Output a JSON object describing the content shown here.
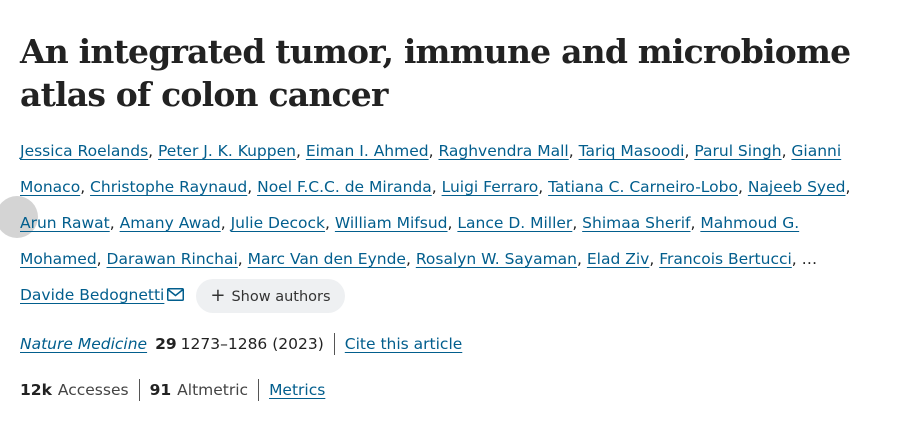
{
  "article": {
    "title": "An integrated tumor, immune and microbiome atlas of colon cancer"
  },
  "authors": [
    "Jessica Roelands",
    "Peter J. K. Kuppen",
    "Eiman I. Ahmed",
    "Raghvendra Mall",
    "Tariq Masoodi",
    "Parul Singh",
    "Gianni Monaco",
    "Christophe Raynaud",
    "Noel F.C.C. de Miranda",
    "Luigi Ferraro",
    "Tatiana C. Carneiro-Lobo",
    "Najeeb Syed",
    "Arun Rawat",
    "Amany Awad",
    "Julie Decock",
    "William Mifsud",
    "Lance D. Miller",
    "Shimaa Sherif",
    "Mahmoud G. Mohamed",
    "Darawan Rinchai",
    "Marc Van den Eynde",
    "Rosalyn W. Sayaman",
    "Elad Ziv",
    "Francois Bertucci"
  ],
  "authors_ellipsis": "…",
  "last_author": "Davide Bedognetti",
  "show_authors_label": "Show authors",
  "citation": {
    "journal": "Nature Medicine",
    "volume": "29",
    "pages_year": "1273–1286 (2023)",
    "cite_label": "Cite this article"
  },
  "metrics": {
    "accesses_value": "12k",
    "accesses_label": "Accesses",
    "altmetric_value": "91",
    "altmetric_label": "Altmetric",
    "metrics_link": "Metrics"
  },
  "colors": {
    "link": "#025e8d",
    "text": "#222222",
    "button_bg": "#eef0f2"
  },
  "icons": {
    "mail": "mail-icon",
    "plus": "plus-icon"
  }
}
